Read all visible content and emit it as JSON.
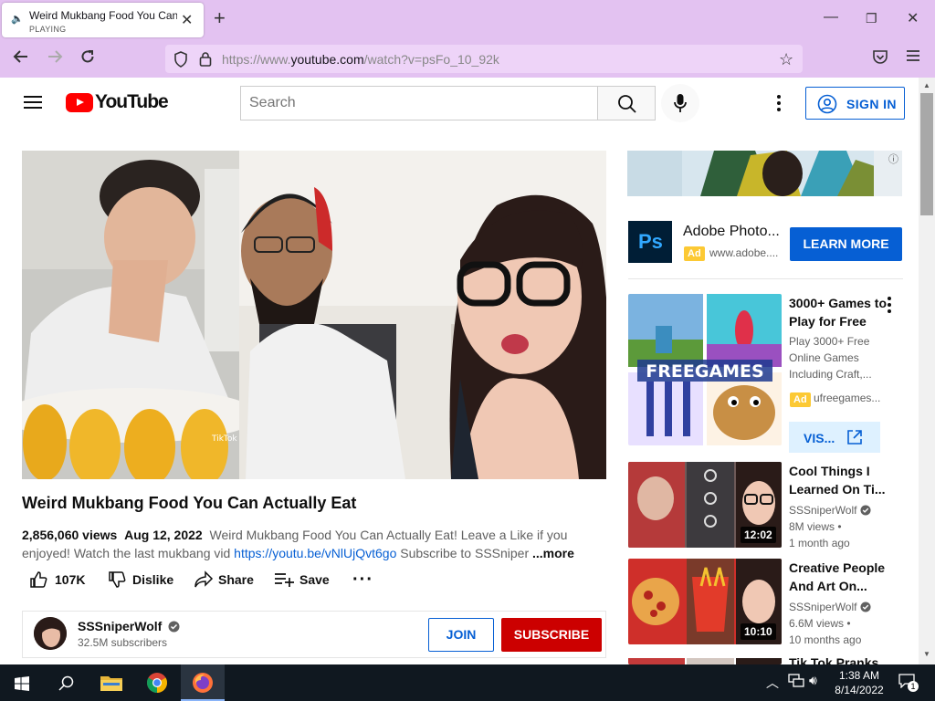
{
  "browser": {
    "tab_title": "Weird Mukbang Food You Can Actually Eat - YouTube",
    "tab_status": "PLAYING",
    "url_prefix": "https://www.",
    "url_host": "youtube.com",
    "url_path": "/watch?v=psFo_10_92k"
  },
  "youtube": {
    "logo_text": "YouTube",
    "search_placeholder": "Search",
    "sign_in": "SIGN IN"
  },
  "video": {
    "title": "Weird Mukbang Food You Can Actually Eat",
    "views": "2,856,060 views",
    "date": "Aug 12, 2022",
    "desc_start": "Weird Mukbang Food You Can Actually Eat! Leave a Like if you enjoyed! Watch the last mukbang vid",
    "desc_link": "https://youtu.be/vNlUjQvt6go",
    "desc_end": "Subscribe to SSSniper",
    "more": "...more",
    "tiktok_mark": "TikTok"
  },
  "actions": {
    "likes": "107K",
    "dislike": "Dislike",
    "share": "Share",
    "save": "Save"
  },
  "channel": {
    "name": "SSSniperWolf",
    "subscribers": "32.5M subscribers",
    "join": "JOIN",
    "subscribe": "SUBSCRIBE"
  },
  "sidebar_ad": {
    "title": "Adobe Photo...",
    "badge": "Ad",
    "domain": "www.adobe....",
    "cta": "LEARN MORE",
    "ps_logo": "Ps"
  },
  "sidebar_items": [
    {
      "title": "3000+ Games to Play for Free",
      "desc": "Play 3000+ Free Online Games Including Craft,...",
      "badge": "Ad",
      "domain": "ufreegames...",
      "cta": "VIS...",
      "thumb_text": "FREEGAMES"
    },
    {
      "title": "Cool Things I Learned On Ti...",
      "channel": "SSSniperWolf",
      "views": "8M views",
      "age": "1 month ago",
      "duration": "12:02"
    },
    {
      "title": "Creative People And Art On...",
      "channel": "SSSniperWolf",
      "views": "6.6M views",
      "age": "10 months ago",
      "duration": "10:10"
    },
    {
      "title": "Tik Tok Pranks"
    }
  ],
  "taskbar": {
    "time": "1:38 AM",
    "date": "8/14/2022",
    "notifications": "1"
  },
  "colors": {
    "browser_chrome": "#e3c2f1",
    "yt_red": "#ff0000",
    "link_blue": "#065fd4",
    "subscribe_red": "#cc0000",
    "taskbar": "#101820"
  }
}
